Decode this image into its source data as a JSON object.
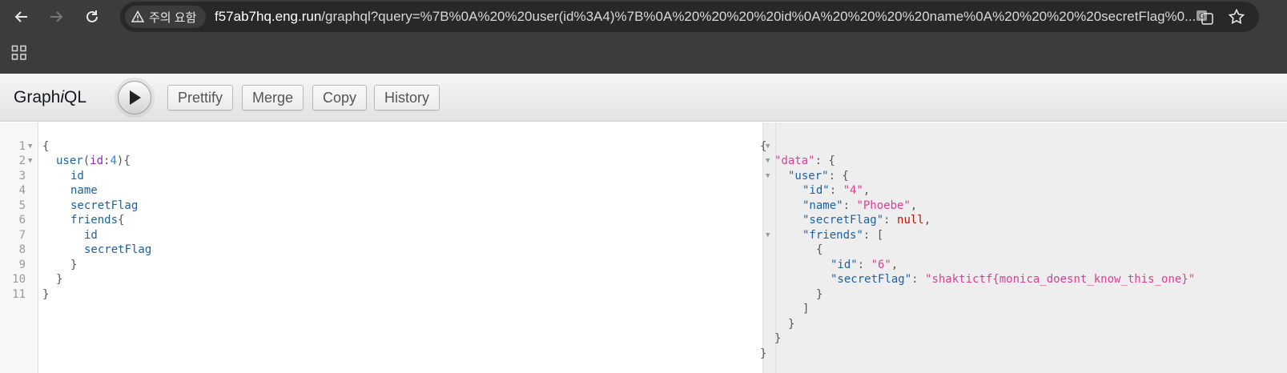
{
  "browser": {
    "security_chip": "주의 요함",
    "url_host": "f57ab7hq.eng.run",
    "url_rest": "/graphql?query=%7B%0A%20%20user(id%3A4)%7B%0A%20%20%20%20id%0A%20%20%20%20name%0A%20%20%20%20secretFlag%0...",
    "icons": [
      "back-arrow-icon",
      "forward-arrow-icon",
      "reload-icon",
      "warning-icon",
      "translate-icon",
      "star-icon",
      "apps-grid-icon"
    ]
  },
  "toolbar": {
    "title_prefix": "Graph",
    "title_italic": "i",
    "title_suffix": "QL",
    "prettify_label": "Prettify",
    "merge_label": "Merge",
    "copy_label": "Copy",
    "history_label": "History"
  },
  "query_editor": {
    "line_numbers": [
      "1",
      "2",
      "3",
      "4",
      "5",
      "6",
      "7",
      "8",
      "9",
      "10",
      "11"
    ],
    "lines": {
      "l1": "{",
      "l2_field": "user",
      "l2_open": "(",
      "l2_arg": "id",
      "l2_colon": ":",
      "l2_val": "4",
      "l2_close": "){",
      "l3": "id",
      "l4": "name",
      "l5": "secretFlag",
      "l6_field": "friends",
      "l6_brace": "{",
      "l7": "id",
      "l8": "secretFlag",
      "l9": "}",
      "l10": "}",
      "l11": "}"
    }
  },
  "result_viewer": {
    "k_data": "\"data\"",
    "k_user": "\"user\"",
    "k_id": "\"id\"",
    "v_id_user": "\"4\"",
    "k_name": "\"name\"",
    "v_name": "\"Phoebe\"",
    "k_secretFlag": "\"secretFlag\"",
    "v_null": "null",
    "k_friends": "\"friends\"",
    "v_id_friend": "\"6\"",
    "v_flag": "\"shaktictf{monica_doesnt_know_this_one}\""
  },
  "colors": {
    "chrome_bg": "#3c3c3c",
    "omnibox_bg": "#282828",
    "string": "#d64292",
    "property": "#1f61a0",
    "number": "#2882f9",
    "null": "#b11a04"
  }
}
